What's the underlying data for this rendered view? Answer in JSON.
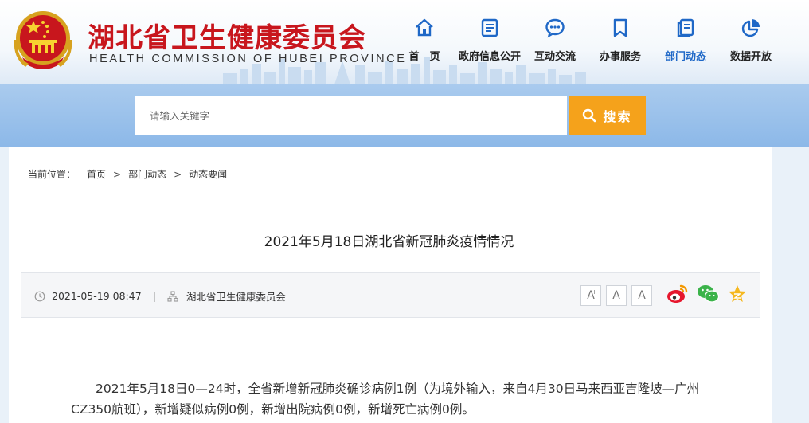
{
  "header": {
    "title_cn": "湖北省卫生健康委员会",
    "title_en": "HEALTH COMMISSION OF HUBEI PROVINCE",
    "nav": [
      {
        "label": "首　页",
        "icon": "home-icon",
        "active": false
      },
      {
        "label": "政府信息公开",
        "icon": "document-icon",
        "active": false
      },
      {
        "label": "互动交流",
        "icon": "chat-icon",
        "active": false
      },
      {
        "label": "办事服务",
        "icon": "bookmark-icon",
        "active": false
      },
      {
        "label": "部门动态",
        "icon": "news-icon",
        "active": true
      },
      {
        "label": "数据开放",
        "icon": "pie-chart-icon",
        "active": false
      }
    ]
  },
  "search": {
    "placeholder": "请输入关键字",
    "button_label": "搜索"
  },
  "breadcrumb": {
    "prefix": "当前位置：",
    "items": [
      "首页",
      "部门动态",
      "动态要闻"
    ],
    "separator": ">"
  },
  "article": {
    "title": "2021年5月18日湖北省新冠肺炎疫情情况",
    "date": "2021-05-19 08:47",
    "divider": "|",
    "source": "湖北省卫生健康委员会",
    "font_sizes": [
      "A",
      "A",
      "A"
    ],
    "body": "2021年5月18日0—24时，全省新增新冠肺炎确诊病例1例（为境外输入，来自4月30日马来西亚吉隆坡—广州CZ350航班），新增疑似病例0例，新增出院病例0例，新增死亡病例0例。"
  },
  "colors": {
    "brand_red": "#c8161d",
    "nav_active": "#1f68c7",
    "search_button": "#f5a21b",
    "band": "#9dc2ec"
  }
}
